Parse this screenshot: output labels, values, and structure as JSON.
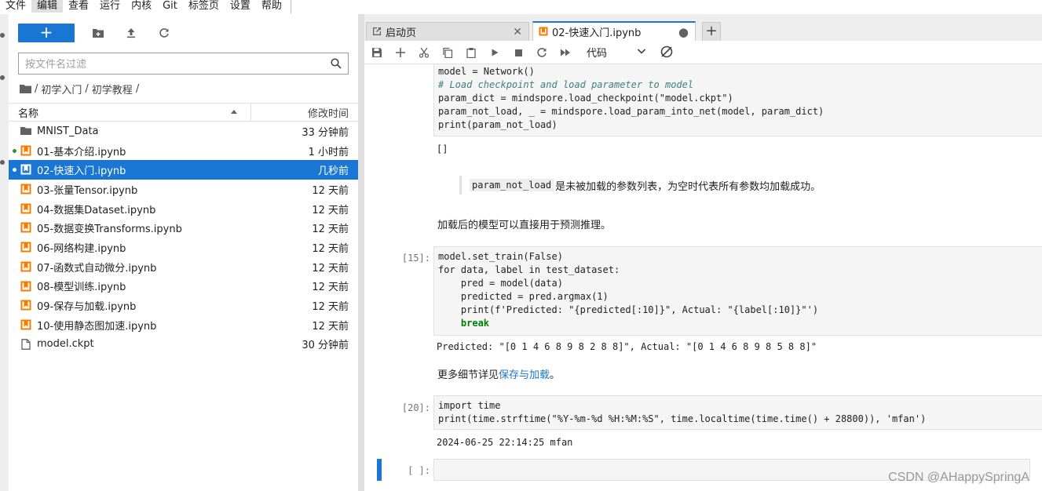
{
  "menu": [
    "文件",
    "编辑",
    "查看",
    "运行",
    "内核",
    "Git",
    "标签页",
    "设置",
    "帮助"
  ],
  "menu_active_index": 1,
  "filebrowser": {
    "new_label": "+",
    "filter_placeholder": "按文件名过滤",
    "breadcrumbs": [
      "/",
      "初学入门",
      "/",
      "初学教程",
      "/"
    ],
    "col_name": "名称",
    "col_modified": "修改时间",
    "items": [
      {
        "name": "MNIST_Data",
        "time": "33 分钟前",
        "type": "folder",
        "running": false,
        "selected": false
      },
      {
        "name": "01-基本介绍.ipynb",
        "time": "1 小时前",
        "type": "notebook",
        "running": true,
        "selected": false
      },
      {
        "name": "02-快速入门.ipynb",
        "time": "几秒前",
        "type": "notebook",
        "running": true,
        "selected": true
      },
      {
        "name": "03-张量Tensor.ipynb",
        "time": "12 天前",
        "type": "notebook",
        "running": false,
        "selected": false
      },
      {
        "name": "04-数据集Dataset.ipynb",
        "time": "12 天前",
        "type": "notebook",
        "running": false,
        "selected": false
      },
      {
        "name": "05-数据变换Transforms.ipynb",
        "time": "12 天前",
        "type": "notebook",
        "running": false,
        "selected": false
      },
      {
        "name": "06-网络构建.ipynb",
        "time": "12 天前",
        "type": "notebook",
        "running": false,
        "selected": false
      },
      {
        "name": "07-函数式自动微分.ipynb",
        "time": "12 天前",
        "type": "notebook",
        "running": false,
        "selected": false
      },
      {
        "name": "08-模型训练.ipynb",
        "time": "12 天前",
        "type": "notebook",
        "running": false,
        "selected": false
      },
      {
        "name": "09-保存与加载.ipynb",
        "time": "12 天前",
        "type": "notebook",
        "running": false,
        "selected": false
      },
      {
        "name": "10-使用静态图加速.ipynb",
        "time": "12 天前",
        "type": "notebook",
        "running": false,
        "selected": false
      },
      {
        "name": "model.ckpt",
        "time": "30 分钟前",
        "type": "file",
        "running": false,
        "selected": false
      }
    ]
  },
  "tabs": {
    "launcher_label": "启动页",
    "notebook_label": "02-快速入门.ipynb",
    "add_label": "+"
  },
  "toolbar": {
    "cell_type": "代码"
  },
  "notebook": {
    "cell1_prompt": "",
    "cell1_lines": [
      "model = Network()",
      "# Load checkpoint and load parameter to model",
      "param_dict = mindspore.load_checkpoint(\"model.ckpt\")",
      "param_not_load, _ = mindspore.load_param_into_net(model, param_dict)",
      "print(param_not_load)"
    ],
    "cell1_output": "[]",
    "quote_code": "param_not_load",
    "quote_text": "是未被加载的参数列表，为空时代表所有参数均加载成功。",
    "md1": "加载后的模型可以直接用于预测推理。",
    "cell2_prompt": "[15]:",
    "cell2_lines": [
      "model.set_train(False)",
      "for data, label in test_dataset:",
      "    pred = model(data)",
      "    predicted = pred.argmax(1)",
      "    print(f'Predicted: \"{predicted[:10]}\", Actual: \"{label[:10]}\"')",
      "    break"
    ],
    "cell2_output": "Predicted: \"[0 1 4 6 8 9 8 2 8 8]\", Actual: \"[0 1 4 6 8 9 8 5 8 8]\"",
    "md2_prefix": "更多细节详见",
    "md2_link": "保存与加载",
    "md2_suffix": "。",
    "cell3_prompt": "[20]:",
    "cell3_lines": [
      "import time",
      "print(time.strftime(\"%Y-%m-%d %H:%M:%S\", time.localtime(time.time() + 28800)), 'mfan')"
    ],
    "cell3_output": "2024-06-25 22:14:25 mfan",
    "cell4_prompt": "[ ]:"
  },
  "watermark": "CSDN @AHappySpringA",
  "colors": {
    "accent": "#1976d2",
    "notebook_icon": "#f57c00",
    "running_dot": "#388e3c"
  }
}
